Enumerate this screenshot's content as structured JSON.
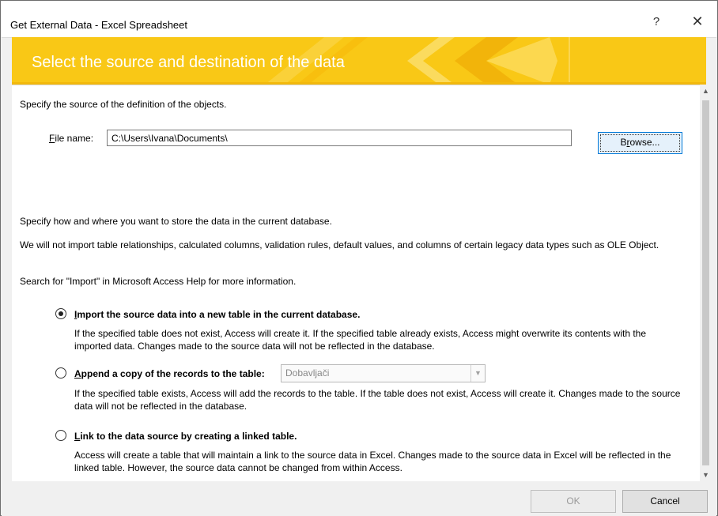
{
  "window": {
    "title": "Get External Data - Excel Spreadsheet",
    "help_label": "?",
    "close_label": "✕"
  },
  "banner": {
    "title": "Select the source and destination of the data"
  },
  "source": {
    "instruction": "Specify the source of the definition of the objects.",
    "file_label_accel": "F",
    "file_label_rest": "ile name:",
    "file_value": "C:\\Users\\Ivana\\Documents\\",
    "browse_pre": "B",
    "browse_accel": "r",
    "browse_post": "owse..."
  },
  "storage": {
    "instruction": "Specify how and where you want to store the data in the current database.",
    "note": "We will not import table relationships, calculated columns, validation rules, default values, and columns of certain legacy data types such as OLE Object.",
    "help_hint": "Search for \"Import\" in Microsoft Access Help for more information."
  },
  "options": [
    {
      "accel": "I",
      "label_rest": "mport the source data into a new table in the current database.",
      "description": "If the specified table does not exist, Access will create it. If the specified table already exists, Access might overwrite its contents with the imported data. Changes made to the source data will not be reflected in the database.",
      "checked": true
    },
    {
      "accel": "A",
      "label_rest": "ppend a copy of the records to the table:",
      "description": "If the specified table exists, Access will add the records to the table. If the table does not exist, Access will create it. Changes made to the source data will not be reflected in the database.",
      "checked": false,
      "select_value": "Dobavljači"
    },
    {
      "accel": "L",
      "label_rest": "ink to the data source by creating a linked table.",
      "description": "Access will create a table that will maintain a link to the source data in Excel. Changes made to the source data in Excel will be reflected in the linked table. However, the source data cannot be changed from within Access.",
      "checked": false
    }
  ],
  "footer": {
    "ok_label": "OK",
    "cancel_label": "Cancel"
  },
  "colors": {
    "banner": "#f9c816",
    "focus_blue": "#0078d7"
  },
  "icons": {
    "scroll_up": "chevron-up-icon",
    "scroll_down": "chevron-down-icon",
    "dropdown": "chevron-down-icon"
  }
}
